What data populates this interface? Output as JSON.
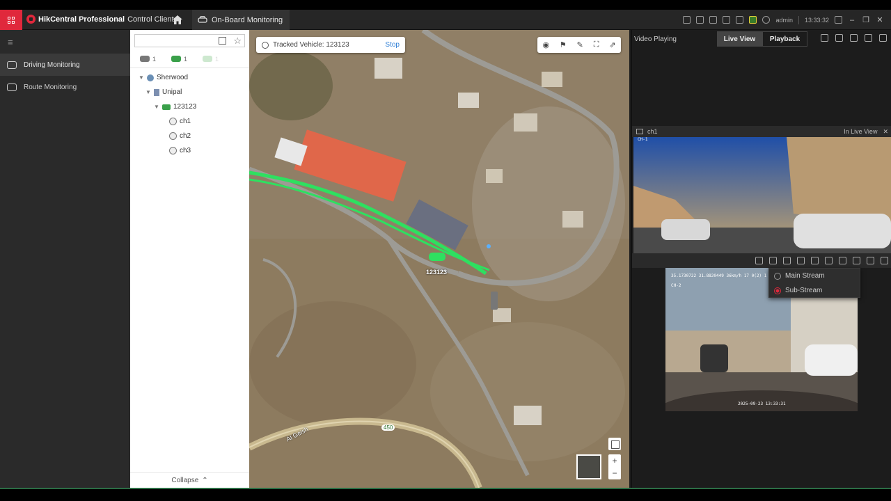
{
  "app": {
    "brand": "HikCentral Professional",
    "subtitle": "Control Client",
    "active_tab": "On-Board Monitoring"
  },
  "titlebar": {
    "user": "admin",
    "time": "13:33:32"
  },
  "leftnav": {
    "items": [
      {
        "label": "Driving Monitoring",
        "active": true
      },
      {
        "label": "Route Monitoring",
        "active": false
      }
    ]
  },
  "tree": {
    "filters": [
      {
        "count": "1"
      },
      {
        "count": "1"
      },
      {
        "count": "1"
      }
    ],
    "nodes": [
      {
        "label": "Sherwood",
        "level": 0,
        "icon": "globe-icon"
      },
      {
        "label": "Unipal",
        "level": 1,
        "icon": "building-icon"
      },
      {
        "label": "123123",
        "level": 2,
        "icon": "vehicle-icon"
      },
      {
        "label": "ch1",
        "level": 3,
        "icon": "camera-icon"
      },
      {
        "label": "ch2",
        "level": 3,
        "icon": "camera-icon"
      },
      {
        "label": "ch3",
        "level": 3,
        "icon": "camera-icon"
      }
    ],
    "collapse_label": "Collapse"
  },
  "map": {
    "tracked_label": "Tracked Vehicle: 123123",
    "stop_label": "Stop",
    "vehicle_label": "123123",
    "road_name": "Al Geish",
    "road_number": "450"
  },
  "video": {
    "header": "Video Playing",
    "live_view": "Live View",
    "playback": "Playback",
    "window_title": "ch1",
    "window_status": "In Live View",
    "osd_ch1": "CH-1",
    "osd_ch2": "CH-2",
    "osd_ch2_coords": "35.1730722 31.8820449 36km/h 17 0(2) 1",
    "osd_ch2_time": "2025-09-23 13:33:31",
    "stream_menu": [
      {
        "label": "Main Stream",
        "selected": false
      },
      {
        "label": "Sub-Stream",
        "selected": true
      }
    ]
  }
}
